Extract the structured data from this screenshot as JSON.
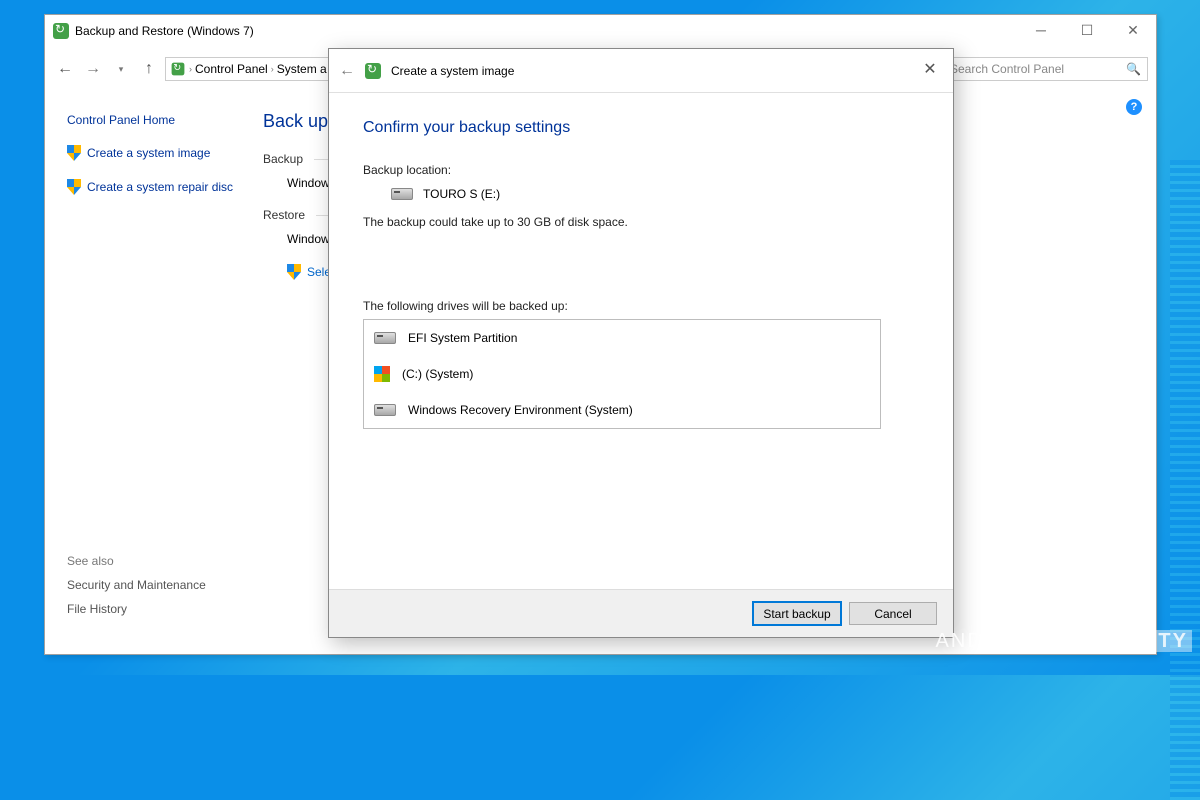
{
  "window": {
    "title": "Backup and Restore (Windows 7)",
    "breadcrumb": {
      "root": "Control Panel",
      "section": "System a"
    },
    "search_placeholder": "Search Control Panel"
  },
  "sidebar": {
    "home": "Control Panel Home",
    "tasks": [
      {
        "label": "Create a system image"
      },
      {
        "label": "Create a system repair disc"
      }
    ],
    "seealso_header": "See also",
    "seealso": [
      {
        "label": "Security and Maintenance"
      },
      {
        "label": "File History"
      }
    ]
  },
  "main": {
    "heading": "Back up o",
    "backup_label": "Backup",
    "backup_text": "Window",
    "restore_label": "Restore",
    "restore_text": "Window",
    "select_link": "Select"
  },
  "dialog": {
    "title": "Create a system image",
    "heading": "Confirm your backup settings",
    "location_label": "Backup location:",
    "location_value": "TOURO S (E:)",
    "size_note": "The backup could take up to 30 GB of disk space.",
    "drives_label": "The following drives will be backed up:",
    "drives": [
      {
        "label": "EFI System Partition",
        "icon": "drive"
      },
      {
        "label": "(C:) (System)",
        "icon": "windows"
      },
      {
        "label": "Windows Recovery Environment (System)",
        "icon": "drive"
      }
    ],
    "primary_button": "Start backup",
    "secondary_button": "Cancel"
  },
  "watermark": {
    "light": "ANDROID",
    "bold": "AUTHORITY"
  }
}
